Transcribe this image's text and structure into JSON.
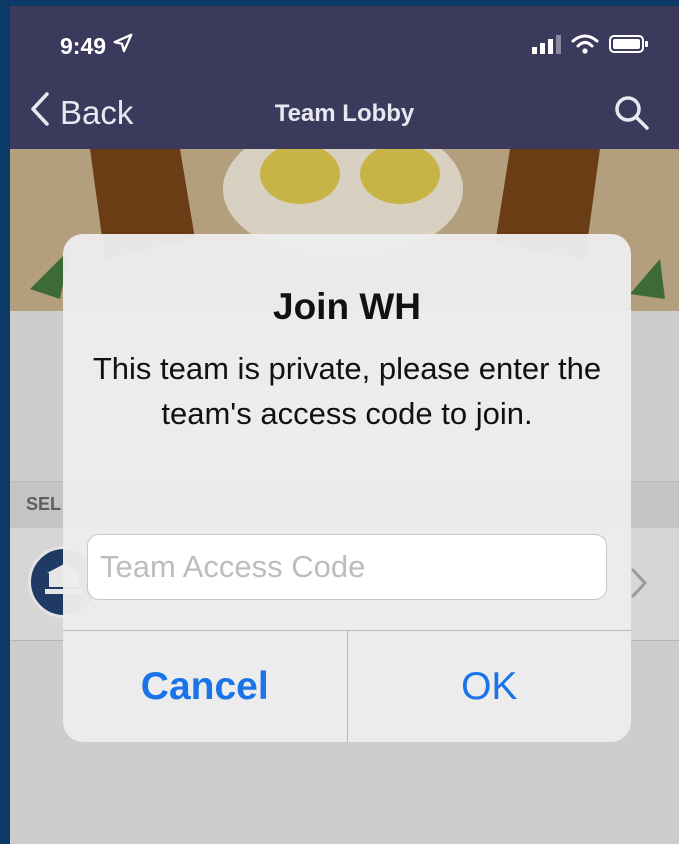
{
  "status_bar": {
    "time": "9:49"
  },
  "nav": {
    "back_label": "Back",
    "title": "Team Lobby"
  },
  "section": {
    "label": "SEL"
  },
  "dialog": {
    "title": "Join WH",
    "message": "This team is private, please enter the team's access code to join.",
    "input_placeholder": "Team Access Code",
    "input_value": "",
    "cancel_label": "Cancel",
    "ok_label": "OK"
  },
  "colors": {
    "nav_bar": "#3b3a5c",
    "accent": "#1a73e8",
    "frame": "#0c3a66"
  }
}
